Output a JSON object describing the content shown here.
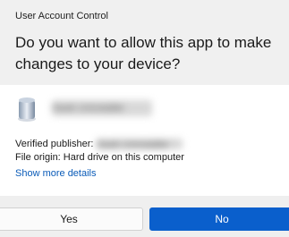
{
  "header": {
    "caption": "User Account Control",
    "question": "Do you want to allow this app to make changes to your device?"
  },
  "app": {
    "icon": "app-icon",
    "name": "Geek Uninstaller"
  },
  "details": {
    "publisher_label": "Verified publisher: ",
    "publisher_value": "Geek Uninstaller",
    "origin_label": "File origin: ",
    "origin_value": "Hard drive on this computer"
  },
  "links": {
    "show_more": "Show more details"
  },
  "buttons": {
    "yes_label": "Yes",
    "no_label": "No"
  },
  "colors": {
    "header_background": "#f0f0f0",
    "link": "#0a5bb8",
    "primary_button": "#0a5fcc"
  }
}
